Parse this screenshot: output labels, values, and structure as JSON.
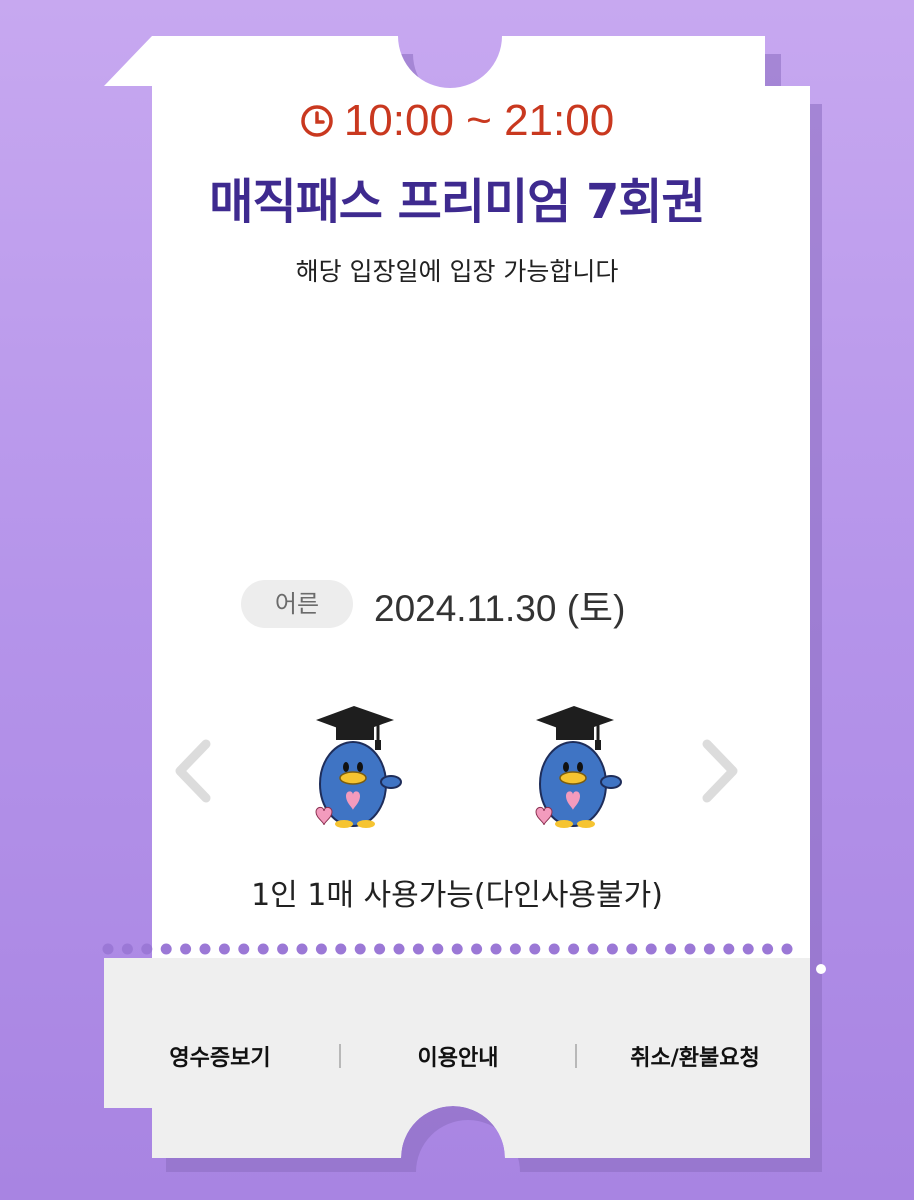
{
  "ticket": {
    "hours": "10:00 ~ 21:00",
    "title": "매직패스 프리미엄 7회권",
    "subtitle": "해당 입장일에 입장 가능합니다",
    "ticket_type": "어른",
    "date": "2024.11.30 (토)",
    "usage_note": "1인 1매 사용가능(다인사용불가)"
  },
  "footer": {
    "receipt": "영수증보기",
    "guide": "이용안내",
    "cancel_refund": "취소/환불요청"
  },
  "icons": {
    "time": "clock-icon",
    "prev": "chevron-left-icon",
    "next": "chevron-right-icon",
    "mascot": "penguin-graduate-mascot"
  },
  "colors": {
    "background": "#b594ea",
    "time_text": "#c9381f",
    "title_text": "#3e2a8f",
    "perforation_dots": "#9b78d6"
  },
  "carousel": {
    "visible_count": 2
  }
}
